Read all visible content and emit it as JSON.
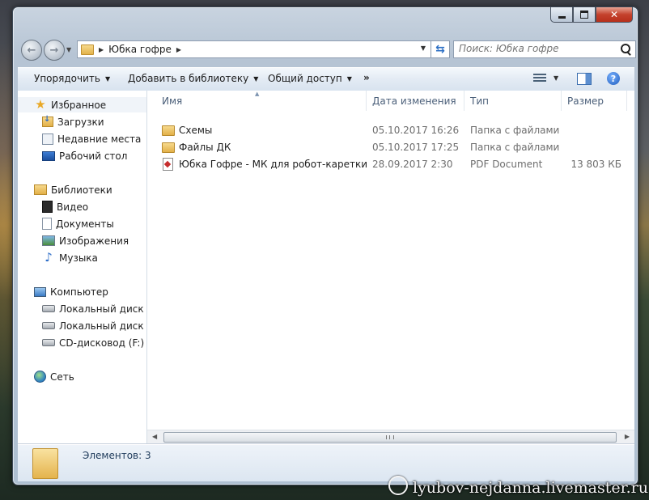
{
  "window": {
    "controls": {
      "minimize": "minimize",
      "maximize": "maximize",
      "close": "✕"
    }
  },
  "nav": {
    "breadcrumb": [
      "Юбка гофре"
    ],
    "search_placeholder": "Поиск: Юбка гофре"
  },
  "toolbar": {
    "organize": "Упорядочить",
    "add_library": "Добавить в библиотеку",
    "share": "Общий доступ",
    "more": "»",
    "help": "?"
  },
  "sidebar": {
    "items": [
      {
        "label": "Избранное",
        "icon": "star-icon",
        "indent": 0,
        "selected": true
      },
      {
        "label": "Загрузки",
        "icon": "downloads-icon",
        "indent": 1
      },
      {
        "label": "Недавние места",
        "icon": "recent-places-icon",
        "indent": 1
      },
      {
        "label": "Рабочий стол",
        "icon": "desktop-icon",
        "indent": 1
      },
      {
        "label": "Библиотеки",
        "icon": "libraries-icon",
        "indent": 0
      },
      {
        "label": "Видео",
        "icon": "video-icon",
        "indent": 1
      },
      {
        "label": "Документы",
        "icon": "documents-icon",
        "indent": 1
      },
      {
        "label": "Изображения",
        "icon": "images-icon",
        "indent": 1
      },
      {
        "label": "Музыка",
        "icon": "music-icon",
        "indent": 1
      },
      {
        "label": "Компьютер",
        "icon": "computer-icon",
        "indent": 0
      },
      {
        "label": "Локальный диск (C:)",
        "icon": "local-disk-icon",
        "indent": 1
      },
      {
        "label": "Локальный диск (E:)",
        "icon": "local-disk-icon",
        "indent": 1
      },
      {
        "label": "CD-дисковод (F:)",
        "icon": "cd-drive-icon",
        "indent": 1
      },
      {
        "label": "Сеть",
        "icon": "network-icon",
        "indent": 0
      }
    ]
  },
  "files": {
    "columns": [
      "Имя",
      "Дата изменения",
      "Тип",
      "Размер"
    ],
    "rows": [
      {
        "name": "Схемы",
        "date": "05.10.2017 16:26",
        "type": "Папка с файлами",
        "size": "",
        "icon": "folder-icon"
      },
      {
        "name": "Файлы ДК",
        "date": "05.10.2017 17:25",
        "type": "Папка с файлами",
        "size": "",
        "icon": "folder-icon"
      },
      {
        "name": "Юбка Гофре - МК для робот-каретки",
        "date": "28.09.2017 2:30",
        "type": "PDF Document",
        "size": "13 803 КБ",
        "icon": "pdf-icon"
      }
    ]
  },
  "details": {
    "count_text": "Элементов: 3"
  },
  "watermark": "lyubov-nejdanna.livemaster.ru"
}
